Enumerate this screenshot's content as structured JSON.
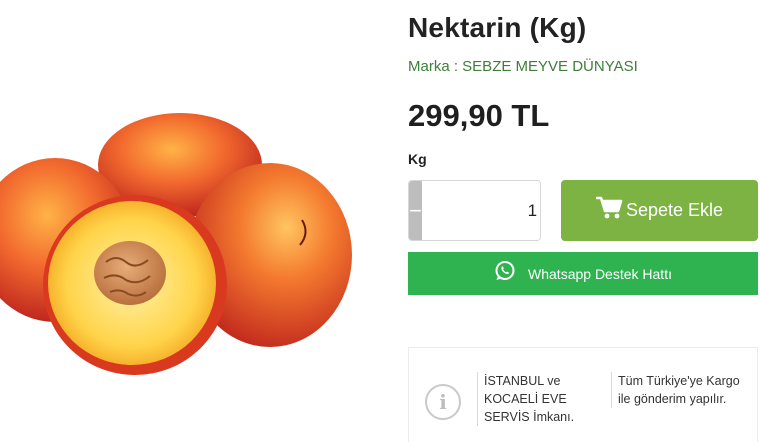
{
  "product": {
    "title": "Nektarin (Kg)",
    "brand": "Marka : SEBZE MEYVE DÜNYASI",
    "price": "299,90 TL",
    "unit": "Kg",
    "image_icon": "nectarine-image"
  },
  "quantity": {
    "minus": "−",
    "value": "1",
    "plus": "+"
  },
  "cart_button": {
    "label": "Sepete Ekle",
    "icon": "cart-icon"
  },
  "whatsapp_button": {
    "label": "Whatsapp Destek Hattı",
    "icon": "whatsapp-icon"
  },
  "info": {
    "icon": "info-icon",
    "icon_glyph": "i",
    "col1": "İSTANBUL ve KOCAELİ EVE SERVİS İmkanı.",
    "col2": "Tüm Türkiye'ye Kargo ile gönderim yapılır."
  },
  "colors": {
    "cart_green": "#7cb342",
    "whatsapp_green": "#2fb350",
    "brand_green": "#3f7d3c",
    "qty_gray": "#bdbdbd"
  }
}
